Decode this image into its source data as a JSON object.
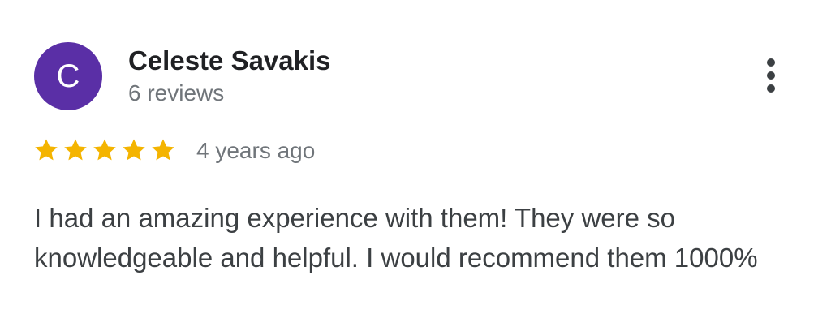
{
  "reviewer": {
    "initial": "C",
    "avatar_color": "#5a2fa6",
    "name": "Celeste Savakis",
    "review_count": "6 reviews"
  },
  "menu": {
    "icon": "more-vert-icon"
  },
  "rating": {
    "stars": 5,
    "max": 5,
    "star_color": "#f4b400"
  },
  "date": "4 years ago",
  "review_text": "I had an amazing experience with them! They were so knowledgeable and helpful. I would recommend them 1000%"
}
